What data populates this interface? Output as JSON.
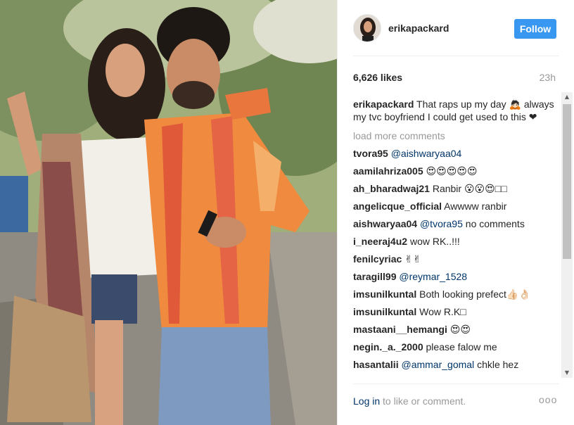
{
  "post": {
    "username": "erikapackard",
    "follow_label": "Follow",
    "likes": "6,626 likes",
    "time": "23h"
  },
  "caption": {
    "user": "erikapackard",
    "text": "That raps up my day 🙇🏻 always my tvc boyfriend I could get used to this ❤"
  },
  "load_more": "load more comments",
  "comments": [
    {
      "user": "tvora95",
      "text": "",
      "mention": "@aishwaryaa04",
      "after": ""
    },
    {
      "user": "aamilahriza005",
      "text": "😍😍😍😍😍",
      "mention": "",
      "after": ""
    },
    {
      "user": "ah_bharadwaj21",
      "text": "Ranbir 😮😮😍□□",
      "mention": "",
      "after": ""
    },
    {
      "user": "angelicque_official",
      "text": "Awwww ranbir",
      "mention": "",
      "after": ""
    },
    {
      "user": "aishwaryaa04",
      "text": "",
      "mention": "@tvora95",
      "after": "no comments"
    },
    {
      "user": "i_neeraj4u2",
      "text": "wow RK..!!!",
      "mention": "",
      "after": ""
    },
    {
      "user": "fenilcyriac",
      "text": "✌✌",
      "mention": "",
      "after": ""
    },
    {
      "user": "taragill99",
      "text": "",
      "mention": "@reymar_1528",
      "after": ""
    },
    {
      "user": "imsunilkuntal",
      "text": "Both looking prefect👍🏻👌🏻",
      "mention": "",
      "after": ""
    },
    {
      "user": "imsunilkuntal",
      "text": "Wow R.K□",
      "mention": "",
      "after": ""
    },
    {
      "user": "mastaani__hemangi",
      "text": "😍😍",
      "mention": "",
      "after": ""
    },
    {
      "user": "negin._a._2000",
      "text": "please falow me",
      "mention": "",
      "after": ""
    },
    {
      "user": "hasantalii",
      "text": "",
      "mention": "@ammar_gomal",
      "after": "chkle hez"
    }
  ],
  "footer": {
    "login": "Log in",
    "login_rest": " to like or comment.",
    "more": "ooo"
  },
  "colors": {
    "accent": "#3897f0",
    "link": "#003569",
    "muted": "#999999"
  }
}
